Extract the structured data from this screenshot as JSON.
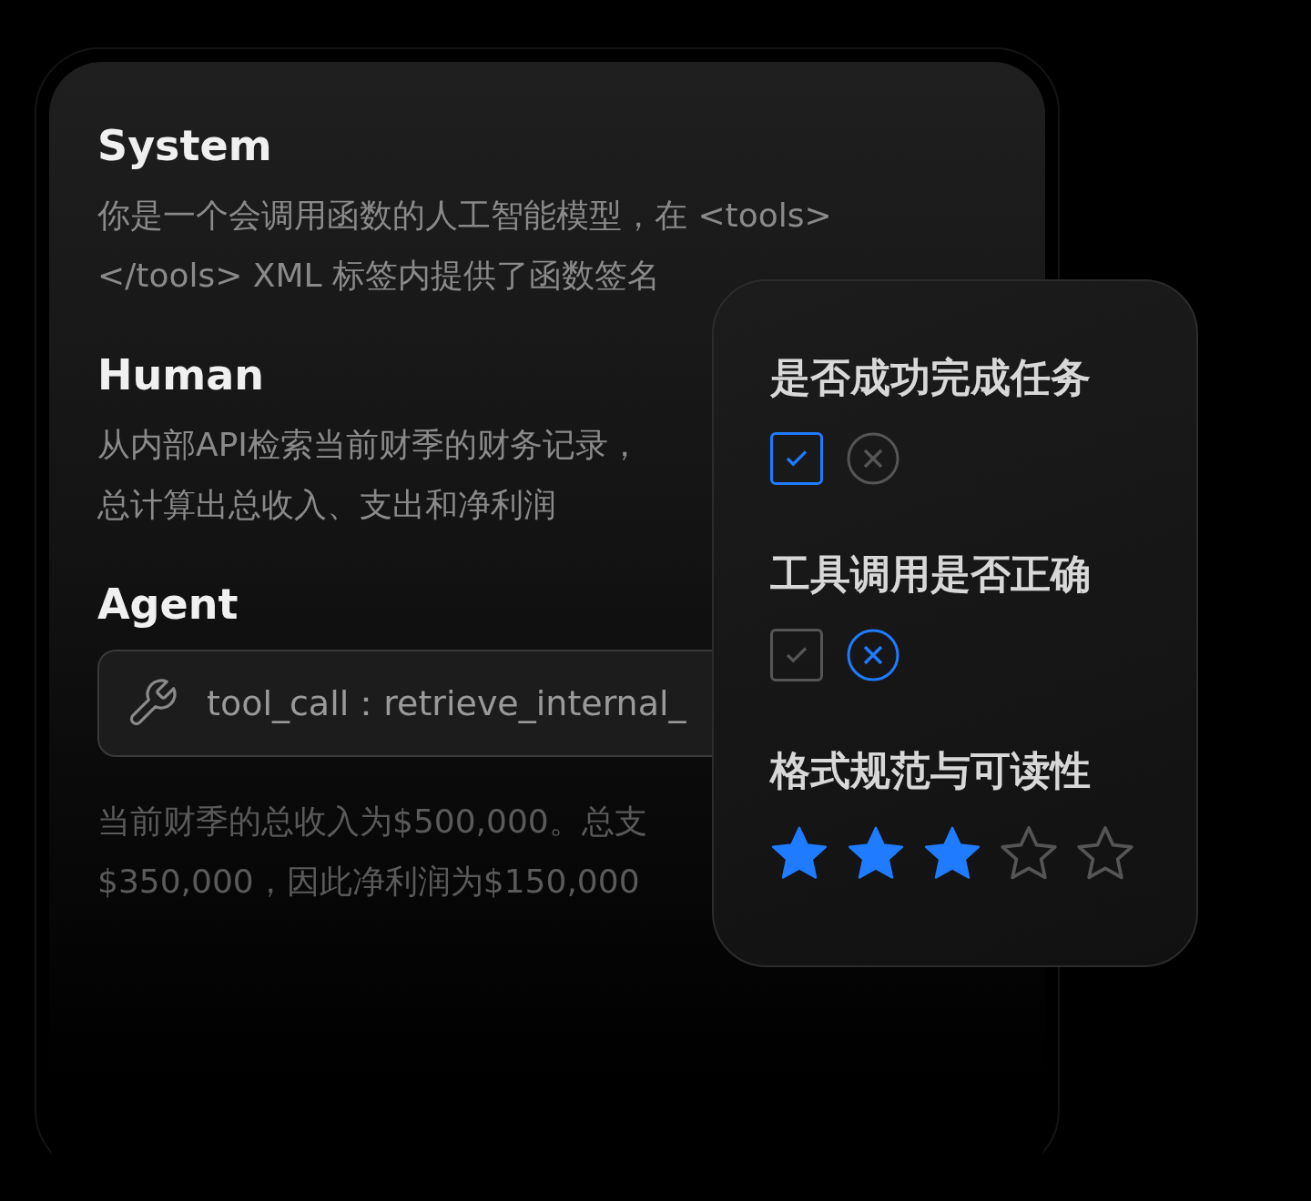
{
  "conversation": [
    {
      "kind": "text",
      "role": "System",
      "lines": [
        "你是一个会调用函数的人工智能模型，在 <tools>",
        "</tools> XML 标签内提供了函数签名"
      ]
    },
    {
      "kind": "text",
      "role": "Human",
      "lines": [
        "从内部API检索当前财季的财务记录，",
        "总计算出总收入、支出和净利润"
      ]
    },
    {
      "kind": "tool",
      "role": "Agent",
      "tool_call": "tool_call：retrieve_internal_",
      "lines": [
        "当前财季的总收入为$500,000。总支",
        "$350,000，因此净利润为$150,000"
      ]
    }
  ],
  "evaluation": [
    {
      "kind": "verdict",
      "question": "是否成功完成任务",
      "options": [
        {
          "kind": "check",
          "selected": true
        },
        {
          "kind": "cross",
          "selected": false
        }
      ]
    },
    {
      "kind": "verdict",
      "question": "工具调用是否正确",
      "options": [
        {
          "kind": "check",
          "selected": false
        },
        {
          "kind": "cross",
          "selected": true
        }
      ]
    },
    {
      "kind": "rating",
      "question": "格式规范与可读性",
      "stars": 3
    }
  ]
}
